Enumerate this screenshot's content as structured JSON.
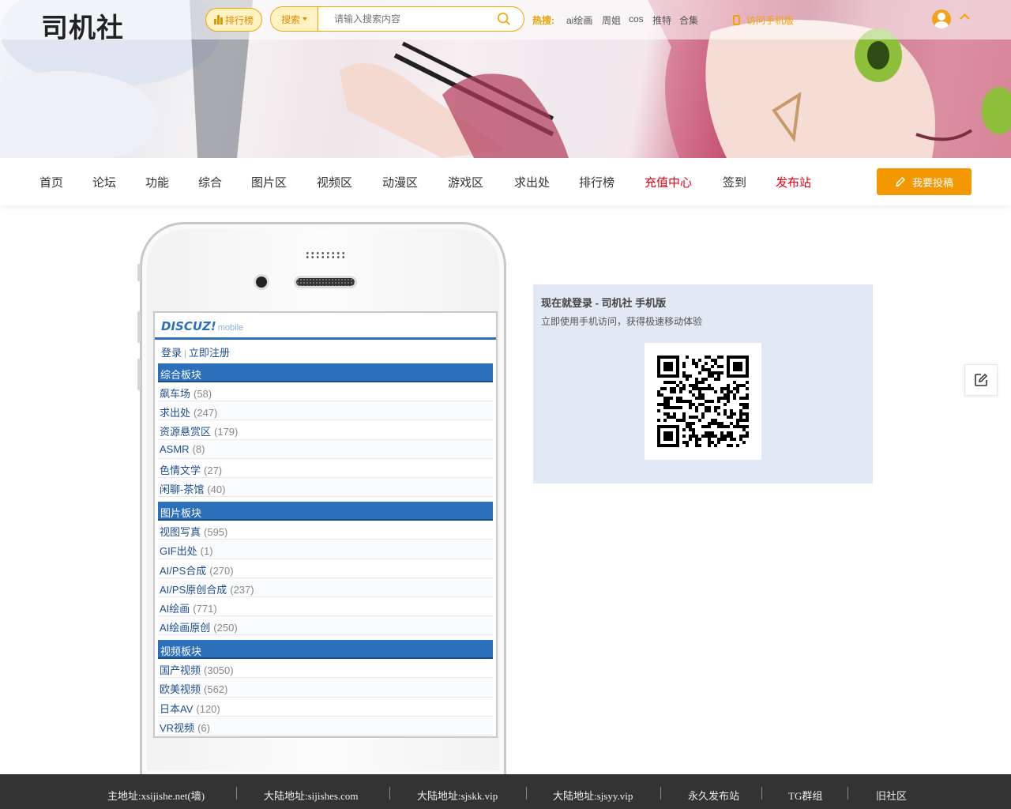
{
  "header": {
    "logo_text": "司机社",
    "rank_label": "排行榜",
    "search": {
      "select_label": "搜索",
      "placeholder": "请输入搜索内容"
    },
    "hot_label": "热搜:",
    "hot_items": [
      "ai绘画",
      "周姐",
      "cos",
      "推特",
      "合集"
    ],
    "mobile_link": "访问手机版"
  },
  "nav": {
    "items": [
      {
        "label": "首页",
        "red": false
      },
      {
        "label": "论坛",
        "red": false
      },
      {
        "label": "功能",
        "red": false
      },
      {
        "label": "综合",
        "red": false
      },
      {
        "label": "图片区",
        "red": false
      },
      {
        "label": "视频区",
        "red": false
      },
      {
        "label": "动漫区",
        "red": false
      },
      {
        "label": "游戏区",
        "red": false
      },
      {
        "label": "求出处",
        "red": false
      },
      {
        "label": "排行榜",
        "red": false
      },
      {
        "label": "充值中心",
        "red": true
      },
      {
        "label": "签到",
        "red": false
      },
      {
        "label": "发布站",
        "red": true
      }
    ],
    "post_button": "我要投稿"
  },
  "phone": {
    "brand": "DISCUZ!",
    "brand_sub": "mobile",
    "login": "登录",
    "register": "立即注册",
    "sections": [
      {
        "title": "综合板块",
        "rows": [
          {
            "name": "飙车场",
            "count": "(58)"
          },
          {
            "name": "求出处",
            "count": "(247)"
          },
          {
            "name": "资源悬赏区",
            "count": "(179)"
          },
          {
            "name": "ASMR",
            "count": "(8)"
          },
          {
            "name": "色情文学",
            "count": "(27)"
          },
          {
            "name": "闲聊-茶馆",
            "count": "(40)"
          }
        ]
      },
      {
        "title": "图片板块",
        "rows": [
          {
            "name": "视图写真",
            "count": "(595)"
          },
          {
            "name": "GIF出处",
            "count": "(1)"
          },
          {
            "name": "AI/PS合成",
            "count": "(270)"
          },
          {
            "name": "AI/PS原创合成",
            "count": "(237)"
          },
          {
            "name": "AI绘画",
            "count": "(771)"
          },
          {
            "name": "AI绘画原创",
            "count": "(250)"
          }
        ]
      },
      {
        "title": "视频板块",
        "rows": [
          {
            "name": "国产视频",
            "count": "(3050)"
          },
          {
            "name": "欧美视频",
            "count": "(562)"
          },
          {
            "name": "日本AV",
            "count": "(120)"
          },
          {
            "name": "VR视频",
            "count": "(6)"
          }
        ]
      }
    ]
  },
  "qr": {
    "title": "现在就登录 - 司机社 手机版",
    "subtitle": "立即使用手机访问，获得极速移动体验"
  },
  "footer": {
    "items": [
      "主地址:xsijishe.net(墙)",
      "大陆地址:sijishes.com",
      "大陆地址:sjskk.vip",
      "大陆地址:sjsyy.vip",
      "永久发布站",
      "TG群组",
      "旧社区"
    ]
  },
  "colors": {
    "accent": "#f39800",
    "nav_red": "#e60012",
    "discuz_blue": "#2c6fba",
    "footer_bg": "#333333"
  }
}
